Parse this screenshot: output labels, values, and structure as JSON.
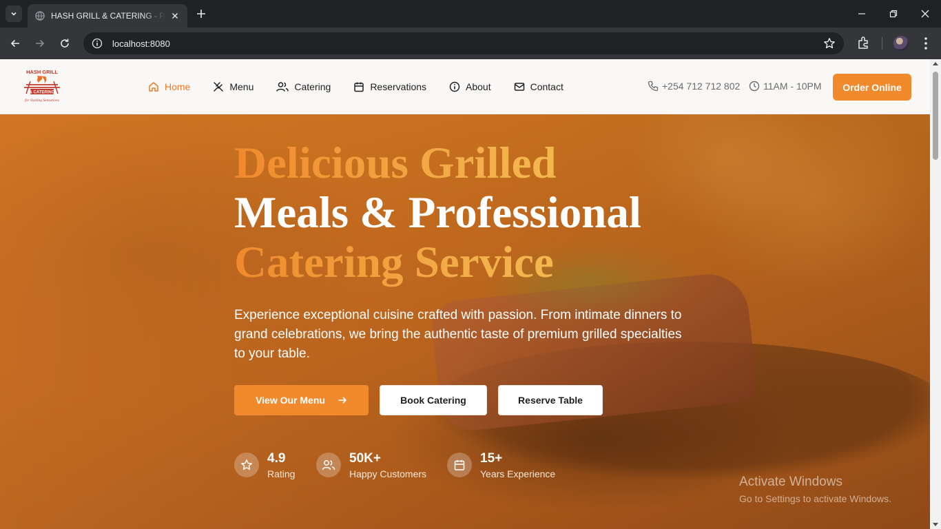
{
  "browser": {
    "tab_title": "HASH GRILL & CATERING - Premium Grill & Catering",
    "url": "localhost:8080"
  },
  "header": {
    "logo": {
      "line1": "HASH GRILL",
      "line2": "& CATERING",
      "tagline": "for Sizzling Sensations"
    },
    "nav": [
      {
        "label": "Home",
        "icon": "home-icon",
        "active": true
      },
      {
        "label": "Menu",
        "icon": "utensils-icon",
        "active": false
      },
      {
        "label": "Catering",
        "icon": "users-icon",
        "active": false
      },
      {
        "label": "Reservations",
        "icon": "calendar-icon",
        "active": false
      },
      {
        "label": "About",
        "icon": "info-icon",
        "active": false
      },
      {
        "label": "Contact",
        "icon": "mail-icon",
        "active": false
      }
    ],
    "phone": "+254 712 712 802",
    "hours": "11AM - 10PM",
    "order_button": "Order Online"
  },
  "hero": {
    "headline": {
      "line1": "Delicious Grilled",
      "line2": "Meals & Professional",
      "line3": "Catering Service"
    },
    "intro": "Experience exceptional cuisine crafted with passion. From intimate dinners to grand celebrations, we bring the authentic taste of premium grilled specialties to your table.",
    "buttons": {
      "menu": "View Our Menu",
      "catering": "Book Catering",
      "reserve": "Reserve Table"
    },
    "stats": [
      {
        "value": "4.9",
        "label": "Rating",
        "icon": "star-icon"
      },
      {
        "value": "50K+",
        "label": "Happy Customers",
        "icon": "users-icon"
      },
      {
        "value": "15+",
        "label": "Years Experience",
        "icon": "calendar-icon"
      }
    ]
  },
  "watermark": {
    "title": "Activate Windows",
    "subtitle": "Go to Settings to activate Windows."
  },
  "colors": {
    "accent": "#f08a2c",
    "accent_light": "#f4c24f",
    "header_bg": "#faf8f6"
  }
}
